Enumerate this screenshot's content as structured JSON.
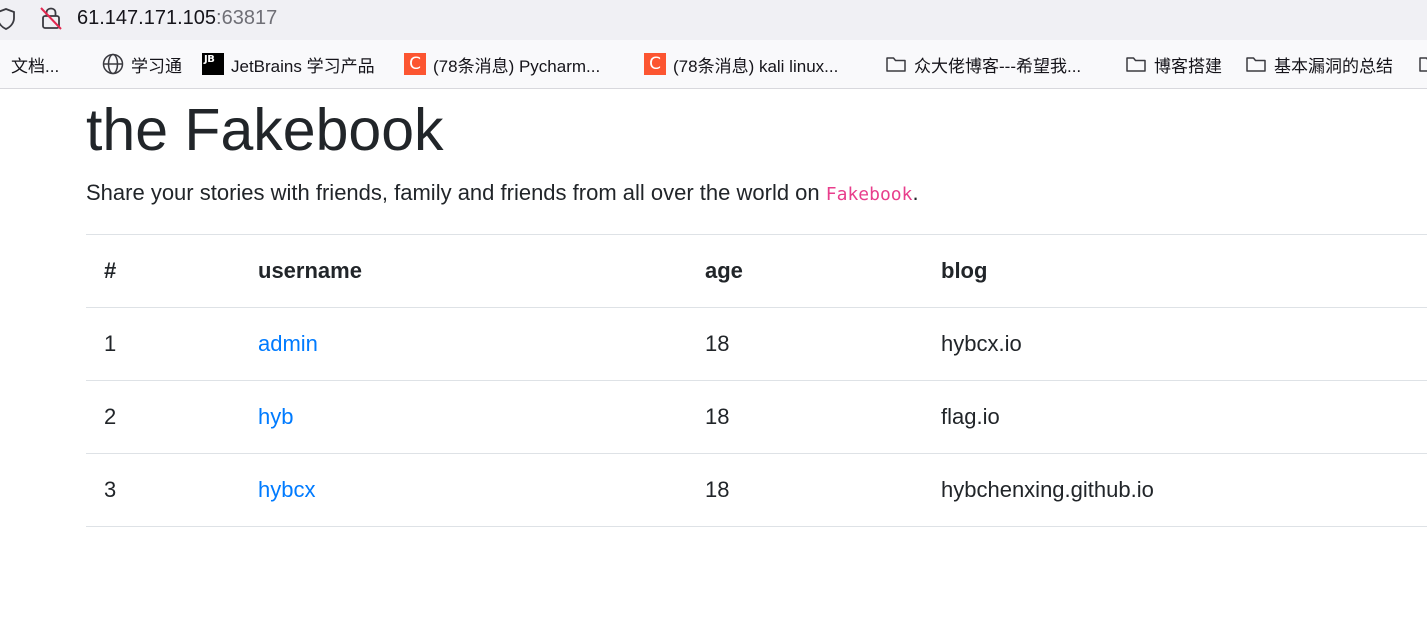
{
  "browser": {
    "url_host": "61.147.171.105",
    "url_port": ":63817",
    "bookmarks": [
      {
        "label": "、文档...",
        "icon": "none"
      },
      {
        "label": "学习通",
        "icon": "globe-icon"
      },
      {
        "label": "JetBrains 学习产品",
        "icon": "jetbrains-icon",
        "icon_text": "JB"
      },
      {
        "label": "(78条消息) Pycharm...",
        "icon": "csdn-icon",
        "icon_text": "C"
      },
      {
        "label": "(78条消息) kali linux...",
        "icon": "csdn-icon",
        "icon_text": "C"
      },
      {
        "label": "众大佬博客---希望我...",
        "icon": "folder-icon"
      },
      {
        "label": "博客搭建",
        "icon": "folder-icon"
      },
      {
        "label": "基本漏洞的总结",
        "icon": "folder-icon"
      }
    ]
  },
  "page": {
    "title": "the Fakebook",
    "lead_prefix": "Share your stories with friends, family and friends from all over the world on ",
    "lead_brand": "Fakebook",
    "lead_suffix": "."
  },
  "table": {
    "headers": [
      "#",
      "username",
      "age",
      "blog"
    ],
    "rows": [
      {
        "no": "1",
        "username": "admin",
        "age": "18",
        "blog": "hybcx.io"
      },
      {
        "no": "2",
        "username": "hyb",
        "age": "18",
        "blog": "flag.io"
      },
      {
        "no": "3",
        "username": "hybcx",
        "age": "18",
        "blog": "hybchenxing.github.io"
      }
    ]
  },
  "colors": {
    "link": "#007bff",
    "code": "#e83e8c",
    "text": "#212529",
    "border": "#dee2e6",
    "csdn": "#fc5531"
  }
}
